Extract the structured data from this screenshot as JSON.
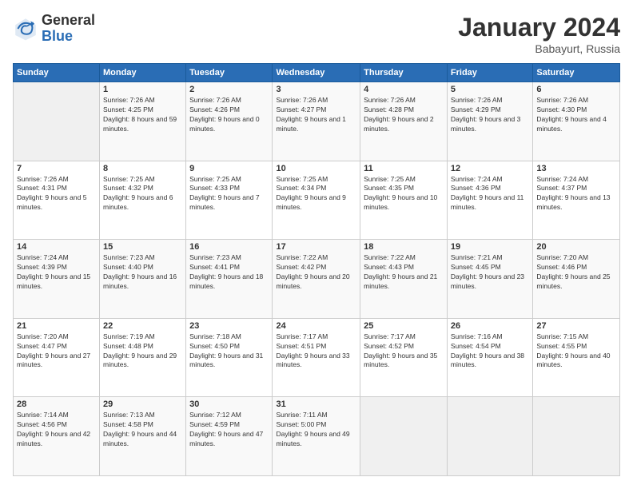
{
  "logo": {
    "general": "General",
    "blue": "Blue"
  },
  "title": "January 2024",
  "subtitle": "Babayurt, Russia",
  "header_days": [
    "Sunday",
    "Monday",
    "Tuesday",
    "Wednesday",
    "Thursday",
    "Friday",
    "Saturday"
  ],
  "weeks": [
    [
      {
        "day": "",
        "sunrise": "",
        "sunset": "",
        "daylight": "",
        "empty": true
      },
      {
        "day": "1",
        "sunrise": "Sunrise: 7:26 AM",
        "sunset": "Sunset: 4:25 PM",
        "daylight": "Daylight: 8 hours and 59 minutes."
      },
      {
        "day": "2",
        "sunrise": "Sunrise: 7:26 AM",
        "sunset": "Sunset: 4:26 PM",
        "daylight": "Daylight: 9 hours and 0 minutes."
      },
      {
        "day": "3",
        "sunrise": "Sunrise: 7:26 AM",
        "sunset": "Sunset: 4:27 PM",
        "daylight": "Daylight: 9 hours and 1 minute."
      },
      {
        "day": "4",
        "sunrise": "Sunrise: 7:26 AM",
        "sunset": "Sunset: 4:28 PM",
        "daylight": "Daylight: 9 hours and 2 minutes."
      },
      {
        "day": "5",
        "sunrise": "Sunrise: 7:26 AM",
        "sunset": "Sunset: 4:29 PM",
        "daylight": "Daylight: 9 hours and 3 minutes."
      },
      {
        "day": "6",
        "sunrise": "Sunrise: 7:26 AM",
        "sunset": "Sunset: 4:30 PM",
        "daylight": "Daylight: 9 hours and 4 minutes."
      }
    ],
    [
      {
        "day": "7",
        "sunrise": "Sunrise: 7:26 AM",
        "sunset": "Sunset: 4:31 PM",
        "daylight": "Daylight: 9 hours and 5 minutes."
      },
      {
        "day": "8",
        "sunrise": "Sunrise: 7:25 AM",
        "sunset": "Sunset: 4:32 PM",
        "daylight": "Daylight: 9 hours and 6 minutes."
      },
      {
        "day": "9",
        "sunrise": "Sunrise: 7:25 AM",
        "sunset": "Sunset: 4:33 PM",
        "daylight": "Daylight: 9 hours and 7 minutes."
      },
      {
        "day": "10",
        "sunrise": "Sunrise: 7:25 AM",
        "sunset": "Sunset: 4:34 PM",
        "daylight": "Daylight: 9 hours and 9 minutes."
      },
      {
        "day": "11",
        "sunrise": "Sunrise: 7:25 AM",
        "sunset": "Sunset: 4:35 PM",
        "daylight": "Daylight: 9 hours and 10 minutes."
      },
      {
        "day": "12",
        "sunrise": "Sunrise: 7:24 AM",
        "sunset": "Sunset: 4:36 PM",
        "daylight": "Daylight: 9 hours and 11 minutes."
      },
      {
        "day": "13",
        "sunrise": "Sunrise: 7:24 AM",
        "sunset": "Sunset: 4:37 PM",
        "daylight": "Daylight: 9 hours and 13 minutes."
      }
    ],
    [
      {
        "day": "14",
        "sunrise": "Sunrise: 7:24 AM",
        "sunset": "Sunset: 4:39 PM",
        "daylight": "Daylight: 9 hours and 15 minutes."
      },
      {
        "day": "15",
        "sunrise": "Sunrise: 7:23 AM",
        "sunset": "Sunset: 4:40 PM",
        "daylight": "Daylight: 9 hours and 16 minutes."
      },
      {
        "day": "16",
        "sunrise": "Sunrise: 7:23 AM",
        "sunset": "Sunset: 4:41 PM",
        "daylight": "Daylight: 9 hours and 18 minutes."
      },
      {
        "day": "17",
        "sunrise": "Sunrise: 7:22 AM",
        "sunset": "Sunset: 4:42 PM",
        "daylight": "Daylight: 9 hours and 20 minutes."
      },
      {
        "day": "18",
        "sunrise": "Sunrise: 7:22 AM",
        "sunset": "Sunset: 4:43 PM",
        "daylight": "Daylight: 9 hours and 21 minutes."
      },
      {
        "day": "19",
        "sunrise": "Sunrise: 7:21 AM",
        "sunset": "Sunset: 4:45 PM",
        "daylight": "Daylight: 9 hours and 23 minutes."
      },
      {
        "day": "20",
        "sunrise": "Sunrise: 7:20 AM",
        "sunset": "Sunset: 4:46 PM",
        "daylight": "Daylight: 9 hours and 25 minutes."
      }
    ],
    [
      {
        "day": "21",
        "sunrise": "Sunrise: 7:20 AM",
        "sunset": "Sunset: 4:47 PM",
        "daylight": "Daylight: 9 hours and 27 minutes."
      },
      {
        "day": "22",
        "sunrise": "Sunrise: 7:19 AM",
        "sunset": "Sunset: 4:48 PM",
        "daylight": "Daylight: 9 hours and 29 minutes."
      },
      {
        "day": "23",
        "sunrise": "Sunrise: 7:18 AM",
        "sunset": "Sunset: 4:50 PM",
        "daylight": "Daylight: 9 hours and 31 minutes."
      },
      {
        "day": "24",
        "sunrise": "Sunrise: 7:17 AM",
        "sunset": "Sunset: 4:51 PM",
        "daylight": "Daylight: 9 hours and 33 minutes."
      },
      {
        "day": "25",
        "sunrise": "Sunrise: 7:17 AM",
        "sunset": "Sunset: 4:52 PM",
        "daylight": "Daylight: 9 hours and 35 minutes."
      },
      {
        "day": "26",
        "sunrise": "Sunrise: 7:16 AM",
        "sunset": "Sunset: 4:54 PM",
        "daylight": "Daylight: 9 hours and 38 minutes."
      },
      {
        "day": "27",
        "sunrise": "Sunrise: 7:15 AM",
        "sunset": "Sunset: 4:55 PM",
        "daylight": "Daylight: 9 hours and 40 minutes."
      }
    ],
    [
      {
        "day": "28",
        "sunrise": "Sunrise: 7:14 AM",
        "sunset": "Sunset: 4:56 PM",
        "daylight": "Daylight: 9 hours and 42 minutes."
      },
      {
        "day": "29",
        "sunrise": "Sunrise: 7:13 AM",
        "sunset": "Sunset: 4:58 PM",
        "daylight": "Daylight: 9 hours and 44 minutes."
      },
      {
        "day": "30",
        "sunrise": "Sunrise: 7:12 AM",
        "sunset": "Sunset: 4:59 PM",
        "daylight": "Daylight: 9 hours and 47 minutes."
      },
      {
        "day": "31",
        "sunrise": "Sunrise: 7:11 AM",
        "sunset": "Sunset: 5:00 PM",
        "daylight": "Daylight: 9 hours and 49 minutes."
      },
      {
        "day": "",
        "sunrise": "",
        "sunset": "",
        "daylight": "",
        "empty": true
      },
      {
        "day": "",
        "sunrise": "",
        "sunset": "",
        "daylight": "",
        "empty": true
      },
      {
        "day": "",
        "sunrise": "",
        "sunset": "",
        "daylight": "",
        "empty": true
      }
    ]
  ]
}
